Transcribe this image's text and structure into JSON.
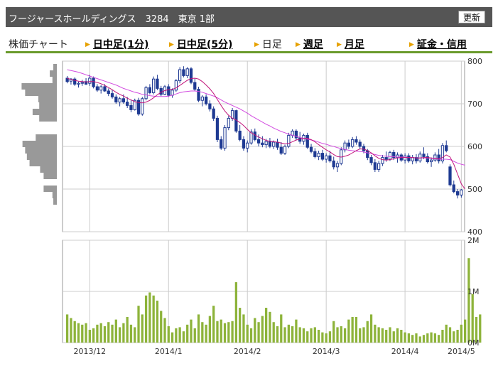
{
  "header": {
    "title": "フージャースホールディングス　3284　東京 1部",
    "refresh_label": "更新"
  },
  "nav": {
    "chart_label": "株価チャート",
    "tabs": [
      {
        "label": "日中足(1分)",
        "link": true
      },
      {
        "label": "日中足(5分)",
        "link": true
      },
      {
        "label": "日足",
        "link": false
      },
      {
        "label": "週足",
        "link": true
      },
      {
        "label": "月足",
        "link": true
      },
      {
        "label": "証金・信用",
        "link": true
      }
    ]
  },
  "colors": {
    "candle": "#1f3a93",
    "ma_short": "#c0147a",
    "ma_long": "#d24be0",
    "volume": "#8db33a",
    "profile": "#999999",
    "grid": "#cccccc",
    "header_bg": "#555555",
    "tab_underline": "#6a9a2c",
    "arrow": "#e6a100"
  },
  "chart_data": [
    {
      "type": "candlestick",
      "ylim": [
        400,
        800
      ],
      "y_ticks": [
        "800",
        "700",
        "600",
        "500",
        "400"
      ],
      "x_ticks": [
        "2013/12",
        "2014/1",
        "2014/2",
        "2014/3",
        "2014/4",
        "2014/5"
      ],
      "candles": [
        [
          760,
          765,
          748,
          752
        ],
        [
          753,
          760,
          745,
          758
        ],
        [
          758,
          762,
          742,
          746
        ],
        [
          746,
          752,
          738,
          748
        ],
        [
          748,
          756,
          742,
          750
        ],
        [
          752,
          760,
          744,
          746
        ],
        [
          748,
          768,
          742,
          760
        ],
        [
          760,
          764,
          736,
          740
        ],
        [
          740,
          746,
          728,
          732
        ],
        [
          732,
          744,
          724,
          740
        ],
        [
          740,
          746,
          728,
          730
        ],
        [
          730,
          736,
          718,
          724
        ],
        [
          724,
          732,
          712,
          716
        ],
        [
          716,
          722,
          700,
          704
        ],
        [
          704,
          716,
          694,
          712
        ],
        [
          712,
          722,
          700,
          704
        ],
        [
          704,
          716,
          690,
          696
        ],
        [
          696,
          708,
          680,
          686
        ],
        [
          686,
          712,
          684,
          708
        ],
        [
          708,
          714,
          672,
          676
        ],
        [
          676,
          716,
          672,
          712
        ],
        [
          712,
          742,
          708,
          738
        ],
        [
          738,
          746,
          722,
          726
        ],
        [
          726,
          764,
          722,
          758
        ],
        [
          758,
          768,
          732,
          736
        ],
        [
          736,
          742,
          718,
          722
        ],
        [
          722,
          744,
          720,
          740
        ],
        [
          740,
          746,
          716,
          720
        ],
        [
          720,
          736,
          714,
          732
        ],
        [
          732,
          758,
          728,
          754
        ],
        [
          754,
          786,
          748,
          780
        ],
        [
          780,
          788,
          762,
          766
        ],
        [
          766,
          786,
          760,
          782
        ],
        [
          782,
          786,
          746,
          750
        ],
        [
          750,
          760,
          730,
          734
        ],
        [
          734,
          740,
          704,
          708
        ],
        [
          708,
          720,
          694,
          716
        ],
        [
          716,
          722,
          696,
          700
        ],
        [
          700,
          708,
          682,
          688
        ],
        [
          688,
          694,
          660,
          666
        ],
        [
          666,
          672,
          610,
          616
        ],
        [
          616,
          624,
          592,
          596
        ],
        [
          596,
          650,
          590,
          644
        ],
        [
          644,
          672,
          638,
          666
        ],
        [
          666,
          690,
          660,
          684
        ],
        [
          684,
          686,
          632,
          636
        ],
        [
          636,
          650,
          612,
          616
        ],
        [
          616,
          624,
          590,
          596
        ],
        [
          596,
          614,
          586,
          608
        ],
        [
          608,
          640,
          604,
          634
        ],
        [
          634,
          642,
          612,
          616
        ],
        [
          616,
          628,
          600,
          608
        ],
        [
          608,
          624,
          598,
          604
        ],
        [
          604,
          618,
          596,
          612
        ],
        [
          612,
          620,
          596,
          600
        ],
        [
          600,
          614,
          594,
          610
        ],
        [
          610,
          618,
          592,
          598
        ],
        [
          598,
          610,
          580,
          584
        ],
        [
          584,
          604,
          580,
          600
        ],
        [
          600,
          632,
          596,
          626
        ],
        [
          626,
          640,
          620,
          636
        ],
        [
          636,
          640,
          614,
          620
        ],
        [
          620,
          634,
          606,
          612
        ],
        [
          612,
          630,
          604,
          626
        ],
        [
          626,
          632,
          594,
          598
        ],
        [
          598,
          606,
          584,
          588
        ],
        [
          588,
          596,
          572,
          576
        ],
        [
          576,
          590,
          568,
          584
        ],
        [
          584,
          592,
          566,
          570
        ],
        [
          570,
          584,
          562,
          578
        ],
        [
          578,
          590,
          562,
          566
        ],
        [
          566,
          576,
          546,
          552
        ],
        [
          552,
          566,
          540,
          560
        ],
        [
          560,
          598,
          556,
          592
        ],
        [
          592,
          614,
          586,
          608
        ],
        [
          608,
          616,
          594,
          600
        ],
        [
          600,
          622,
          596,
          616
        ],
        [
          616,
          624,
          604,
          610
        ],
        [
          610,
          616,
          594,
          600
        ],
        [
          600,
          606,
          584,
          590
        ],
        [
          590,
          594,
          568,
          574
        ],
        [
          574,
          580,
          556,
          562
        ],
        [
          562,
          570,
          540,
          546
        ],
        [
          546,
          566,
          540,
          560
        ],
        [
          560,
          580,
          554,
          574
        ],
        [
          574,
          588,
          564,
          570
        ],
        [
          570,
          590,
          566,
          586
        ],
        [
          586,
          592,
          568,
          574
        ],
        [
          574,
          586,
          562,
          580
        ],
        [
          580,
          584,
          564,
          568
        ],
        [
          568,
          584,
          560,
          578
        ],
        [
          578,
          584,
          562,
          566
        ],
        [
          566,
          580,
          558,
          574
        ],
        [
          574,
          582,
          560,
          566
        ],
        [
          566,
          588,
          562,
          582
        ],
        [
          582,
          598,
          570,
          576
        ],
        [
          576,
          584,
          560,
          564
        ],
        [
          564,
          574,
          552,
          568
        ],
        [
          568,
          586,
          564,
          580
        ],
        [
          580,
          594,
          560,
          566
        ],
        [
          566,
          608,
          560,
          602
        ],
        [
          602,
          614,
          586,
          590
        ],
        [
          552,
          558,
          506,
          510
        ],
        [
          510,
          520,
          490,
          494
        ],
        [
          494,
          500,
          478,
          486
        ],
        [
          486,
          500,
          480,
          498
        ]
      ],
      "ma_short": [
        760,
        757,
        755,
        753,
        752,
        751,
        752,
        752,
        750,
        747,
        743,
        738,
        733,
        727,
        722,
        718,
        713,
        709,
        705,
        703,
        702,
        704,
        708,
        714,
        721,
        727,
        731,
        733,
        734,
        737,
        743,
        749,
        755,
        759,
        760,
        758,
        752,
        744,
        735,
        724,
        710,
        696,
        683,
        673,
        666,
        662,
        656,
        649,
        640,
        632,
        627,
        622,
        618,
        614,
        612,
        611,
        610,
        608,
        606,
        607,
        611,
        615,
        617,
        619,
        619,
        616,
        611,
        604,
        598,
        592,
        587,
        581,
        576,
        575,
        577,
        580,
        585,
        590,
        594,
        594,
        590,
        585,
        578,
        572,
        569,
        568,
        569,
        571,
        573,
        574,
        574,
        574,
        574,
        573,
        573,
        574,
        574,
        573,
        572,
        571,
        574,
        580,
        575,
        558,
        535,
        512,
        500
      ],
      "ma_long": [
        780,
        778,
        776,
        774,
        771,
        768,
        765,
        762,
        759,
        756,
        753,
        750,
        747,
        744,
        740,
        736,
        733,
        730,
        727,
        725,
        722,
        721,
        719,
        718,
        717,
        717,
        717,
        718,
        720,
        723,
        726,
        728,
        729,
        730,
        730,
        729,
        727,
        724,
        721,
        718,
        714,
        709,
        704,
        700,
        696,
        692,
        688,
        683,
        678,
        672,
        667,
        662,
        657,
        652,
        648,
        643,
        639,
        635,
        632,
        629,
        626,
        624,
        621,
        619,
        617,
        615,
        613,
        610,
        607,
        605,
        602,
        600,
        597,
        595,
        593,
        591,
        590,
        589,
        588,
        587,
        585,
        583,
        581,
        579,
        578,
        577,
        576,
        576,
        575,
        575,
        575,
        574,
        574,
        573,
        573,
        573,
        573,
        572,
        571,
        570,
        570,
        570,
        569,
        565,
        561,
        558,
        556
      ],
      "volume_ylim": [
        0,
        2
      ],
      "volume_ticks": [
        "2M",
        "1M",
        "0M"
      ],
      "volumes": [
        0.55,
        0.48,
        0.42,
        0.38,
        0.35,
        0.38,
        0.25,
        0.28,
        0.35,
        0.38,
        0.32,
        0.4,
        0.35,
        0.45,
        0.3,
        0.38,
        0.5,
        0.35,
        0.3,
        0.72,
        0.55,
        0.92,
        0.98,
        0.92,
        0.82,
        0.62,
        0.48,
        0.32,
        0.2,
        0.28,
        0.3,
        0.22,
        0.35,
        0.45,
        0.28,
        0.55,
        0.4,
        0.35,
        0.52,
        0.72,
        0.42,
        0.45,
        0.38,
        0.4,
        0.42,
        1.18,
        0.68,
        0.55,
        0.35,
        0.28,
        0.48,
        0.4,
        0.52,
        0.68,
        0.6,
        0.4,
        0.32,
        0.55,
        0.3,
        0.35,
        0.32,
        0.45,
        0.3,
        0.28,
        0.22,
        0.28,
        0.3,
        0.25,
        0.2,
        0.18,
        0.22,
        0.42,
        0.3,
        0.32,
        0.28,
        0.45,
        0.5,
        0.5,
        0.28,
        0.3,
        0.42,
        0.55,
        0.35,
        0.3,
        0.28,
        0.25,
        0.3,
        0.22,
        0.28,
        0.25,
        0.2,
        0.18,
        0.15,
        0.18,
        0.12,
        0.15,
        0.18,
        0.2,
        0.18,
        0.15,
        0.25,
        0.35,
        0.3,
        0.22,
        0.25,
        0.35,
        0.45,
        1.65,
        0.95,
        0.5,
        0.55
      ]
    },
    {
      "type": "bar",
      "orientation": "horizontal",
      "price_levels": [
        785,
        770,
        755,
        740,
        725,
        710,
        695,
        680,
        665,
        650,
        635,
        620,
        605,
        590,
        575,
        560,
        545,
        530,
        515,
        500,
        485,
        470
      ],
      "volume_at_price": [
        0.08,
        0.16,
        0.1,
        0.8,
        0.72,
        0.42,
        0.4,
        0.55,
        0.4,
        0,
        0,
        0.48,
        0.78,
        0.72,
        0.68,
        0.62,
        0.38,
        0.3,
        0,
        0.3,
        0.1,
        0.08
      ]
    }
  ]
}
